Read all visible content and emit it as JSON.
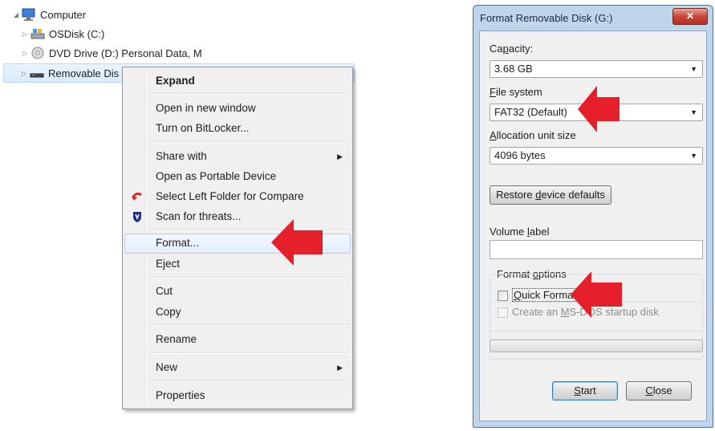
{
  "tree": {
    "items": [
      {
        "label": "Computer"
      },
      {
        "label": "OSDisk (C:)"
      },
      {
        "label": "DVD Drive (D:) Personal Data, M"
      },
      {
        "label": "Removable Dis"
      }
    ]
  },
  "context_menu": {
    "items": [
      {
        "label": "Expand"
      },
      {
        "label": "Open in new window"
      },
      {
        "label": "Turn on BitLocker..."
      },
      {
        "label": "Share with"
      },
      {
        "label": "Open as Portable Device"
      },
      {
        "label": "Select Left Folder for Compare"
      },
      {
        "label": "Scan for threats..."
      },
      {
        "label": "Format..."
      },
      {
        "label": "Eject"
      },
      {
        "label": "Cut"
      },
      {
        "label": "Copy"
      },
      {
        "label": "Rename"
      },
      {
        "label": "New"
      },
      {
        "label": "Properties"
      }
    ]
  },
  "dialog": {
    "title": "Format Removable Disk (G:)",
    "close_label": "✕",
    "capacity": {
      "label_pre": "Ca",
      "label_key": "p",
      "label_post": "acity:",
      "value": "3.68 GB"
    },
    "file_system": {
      "label_key": "F",
      "label_post": "ile system",
      "value": "FAT32 (Default)"
    },
    "allocation": {
      "label_key": "A",
      "label_post": "llocation unit size",
      "value": "4096 bytes"
    },
    "restore": {
      "label_pre": "Restore ",
      "label_key": "d",
      "label_post": "evice defaults"
    },
    "volume": {
      "label_pre": "Volume ",
      "label_key": "l",
      "label_post": "abel",
      "value": ""
    },
    "format_options": {
      "title_pre": "Format ",
      "title_key": "o",
      "title_post": "ptions",
      "quick_pre": "",
      "quick_key": "Q",
      "quick_post": "uick Format",
      "msdos_pre": "Create an ",
      "msdos_key": "M",
      "msdos_post": "S-DOS startup disk"
    },
    "start": {
      "label_key": "S",
      "label_post": "tart"
    },
    "close": {
      "label_key": "C",
      "label_post": "lose"
    }
  },
  "colors": {
    "annotation_arrow": "#e5202a",
    "selection": "#d7eafc",
    "dialog_frame": "#bfd5ec"
  }
}
